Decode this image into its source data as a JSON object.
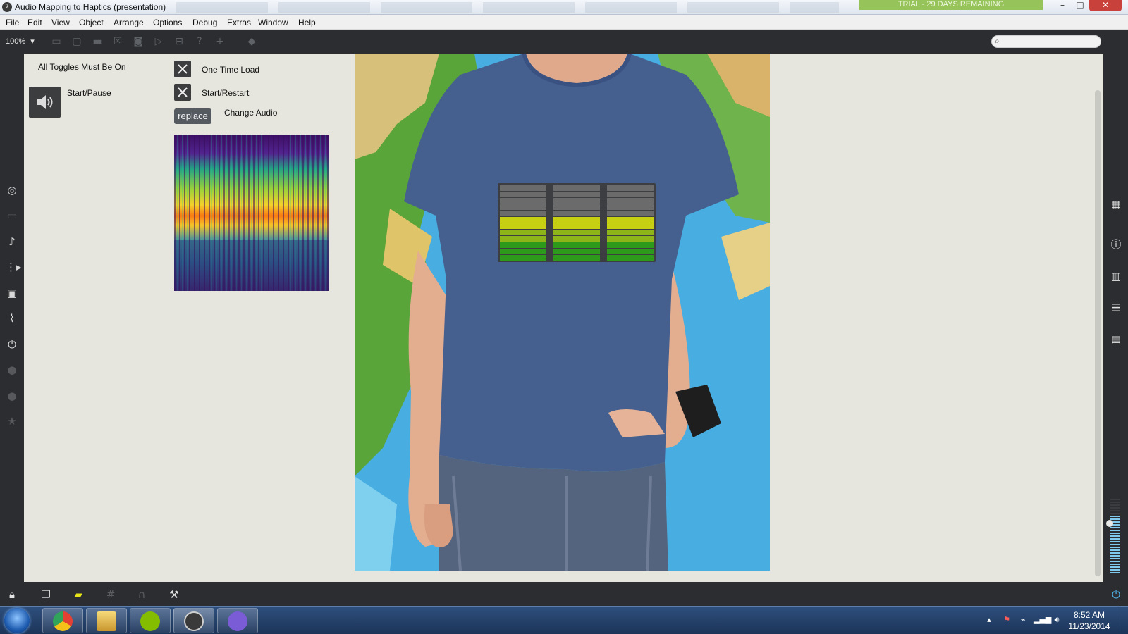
{
  "window": {
    "title": "Audio Mapping to Haptics (presentation)",
    "trial_notice": "TRIAL - 29 DAYS REMAINING",
    "app_icon_glyph": "7",
    "controls": {
      "minimize": "–",
      "maximize": "□",
      "close": "✕"
    }
  },
  "menubar": {
    "items": [
      "File",
      "Edit",
      "View",
      "Object",
      "Arrange",
      "Options",
      "Debug",
      "Extras",
      "Window",
      "Help"
    ]
  },
  "toolbar": {
    "zoom": "100%",
    "zoom_arrow": "▾",
    "icons": [
      "panel-icon",
      "comment-icon",
      "speech-bubble-icon",
      "x-box-icon",
      "object-box-icon",
      "play-box-icon",
      "split-box-icon",
      "help-icon",
      "add-icon",
      "paint-bucket-icon"
    ],
    "search_placeholder": ""
  },
  "left_sidebar": {
    "icons": [
      "target-icon",
      "film-icon",
      "music-note-icon",
      "step-sequencer-icon",
      "image-icon",
      "paperclip-icon",
      "plug-icon",
      "circle-v-icon",
      "circle-d-icon",
      "star-icon"
    ]
  },
  "right_sidebar": {
    "icons": [
      "keyboard-icon",
      "info-icon",
      "columns-icon",
      "list-icon",
      "book-icon"
    ],
    "volume_level": 0.78
  },
  "patcher": {
    "all_toggles_label": "All Toggles Must Be On",
    "start_pause_label": "Start/Pause",
    "one_time_load_label": "One Time Load",
    "start_restart_label": "Start/Restart",
    "replace_button": "replace",
    "change_audio_label": "Change Audio"
  },
  "haptic_meters": {
    "columns": 3,
    "segments_per_column": 12,
    "lit_segments": [
      7,
      7,
      7
    ],
    "colors": {
      "off": "#6b6b6b",
      "low": "#2e9a1c",
      "mid": "#8db51a",
      "high": "#c7cf13"
    }
  },
  "bottombar": {
    "icons": [
      "lock-icon",
      "windows-icon",
      "chat-icon",
      "grid-icon",
      "magnet-icon",
      "wrench-icon",
      "power-icon"
    ]
  },
  "taskbar": {
    "apps": [
      "chrome-icon",
      "file-explorer-icon",
      "spotify-icon",
      "max-app-icon",
      "github-icon"
    ],
    "tray_icons": [
      "show-hidden-icon",
      "action-center-flag-icon",
      "power-plug-icon",
      "network-icon",
      "volume-icon"
    ],
    "time": "8:52 AM",
    "date": "11/23/2014"
  },
  "colors": {
    "accent_green": "#96c35a",
    "dark_chrome": "#2b2d30",
    "canvas_bg": "#e6e6df"
  }
}
